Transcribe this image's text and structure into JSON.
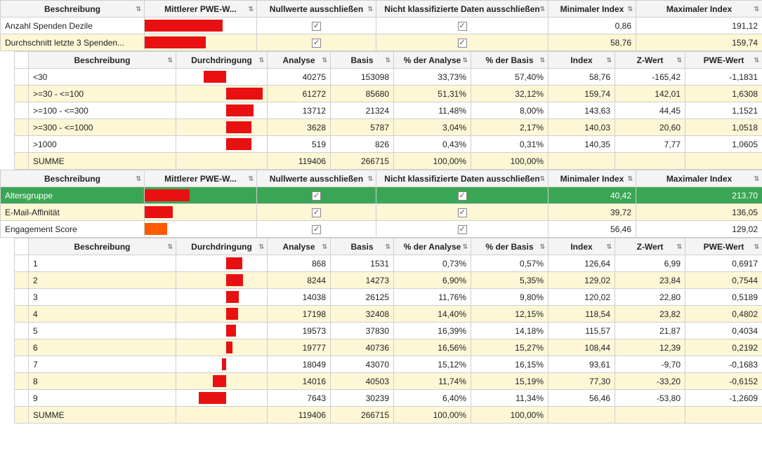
{
  "masterHeaders": {
    "beschreibung": "Beschreibung",
    "mittlererPWE": "Mittlerer  PWE-W...",
    "nullwerte": "Nullwerte ausschließen",
    "nichtKlass": "Nicht klassifizierte Daten ausschließen",
    "minIndex": "Minimaler Index",
    "maxIndex": "Maximaler Index"
  },
  "detailHeaders": {
    "beschreibung": "Beschreibung",
    "durchdringung": "Durchdringung",
    "analyse": "Analyse",
    "basis": "Basis",
    "pctAnalyse": "% der Analyse",
    "pctBasis": "% der Basis",
    "index": "Index",
    "zwert": "Z-Wert",
    "pwe": "PWE-Wert"
  },
  "master1": [
    {
      "name": "Anzahl Spenden Dezile",
      "barStart": 0,
      "barWidth": 70,
      "chk1": true,
      "chk2": true,
      "min": "0,86",
      "max": "191,12",
      "alt": false,
      "sel": false
    },
    {
      "name": "Durchschnitt letzte  3  Spenden...",
      "barStart": 0,
      "barWidth": 55,
      "chk1": true,
      "chk2": true,
      "min": "58,76",
      "max": "159,74",
      "alt": true,
      "sel": false
    }
  ],
  "detail1": [
    {
      "name": "<30",
      "barStart": 30,
      "barWidth": 25,
      "analyse": "40275",
      "basis": "153098",
      "pctA": "33,73%",
      "pctB": "57,40%",
      "idx": "58,76",
      "z": "-165,42",
      "pwe": "-1,1831",
      "alt": false
    },
    {
      "name": ">=30 - <=100",
      "barStart": 55,
      "barWidth": 40,
      "analyse": "61272",
      "basis": "85680",
      "pctA": "51,31%",
      "pctB": "32,12%",
      "idx": "159,74",
      "z": "142,01",
      "pwe": "1,6308",
      "alt": true
    },
    {
      "name": ">=100 - <=300",
      "barStart": 55,
      "barWidth": 30,
      "analyse": "13712",
      "basis": "21324",
      "pctA": "11,48%",
      "pctB": "8,00%",
      "idx": "143,63",
      "z": "44,45",
      "pwe": "1,1521",
      "alt": false
    },
    {
      "name": ">=300 - <=1000",
      "barStart": 55,
      "barWidth": 28,
      "analyse": "3628",
      "basis": "5787",
      "pctA": "3,04%",
      "pctB": "2,17%",
      "idx": "140,03",
      "z": "20,60",
      "pwe": "1,0518",
      "alt": true
    },
    {
      "name": ">1000",
      "barStart": 55,
      "barWidth": 28,
      "analyse": "519",
      "basis": "826",
      "pctA": "0,43%",
      "pctB": "0,31%",
      "idx": "140,35",
      "z": "7,77",
      "pwe": "1,0605",
      "alt": false
    },
    {
      "name": "SUMME",
      "barStart": 0,
      "barWidth": 0,
      "analyse": "119406",
      "basis": "266715",
      "pctA": "100,00%",
      "pctB": "100,00%",
      "idx": "",
      "z": "",
      "pwe": "",
      "alt": true
    }
  ],
  "master2": [
    {
      "name": "Altersgruppe",
      "barStart": 0,
      "barWidth": 40,
      "barClass": "",
      "chk1": true,
      "chk2": true,
      "min": "40,42",
      "max": "213,70",
      "alt": false,
      "sel": true
    },
    {
      "name": "E-Mail-Affinität",
      "barStart": 0,
      "barWidth": 25,
      "barClass": "",
      "chk1": true,
      "chk2": true,
      "min": "39,72",
      "max": "136,05",
      "alt": true,
      "sel": false
    },
    {
      "name": "Engagement Score",
      "barStart": 0,
      "barWidth": 20,
      "barClass": "orange",
      "chk1": true,
      "chk2": true,
      "min": "56,46",
      "max": "129,02",
      "alt": false,
      "sel": false
    }
  ],
  "detail2": [
    {
      "name": "1",
      "barStart": 55,
      "barWidth": 18,
      "analyse": "868",
      "basis": "1531",
      "pctA": "0,73%",
      "pctB": "0,57%",
      "idx": "126,64",
      "z": "6,99",
      "pwe": "0,6917",
      "alt": false
    },
    {
      "name": "2",
      "barStart": 55,
      "barWidth": 19,
      "analyse": "8244",
      "basis": "14273",
      "pctA": "6,90%",
      "pctB": "5,35%",
      "idx": "129,02",
      "z": "23,84",
      "pwe": "0,7544",
      "alt": true
    },
    {
      "name": "3",
      "barStart": 55,
      "barWidth": 14,
      "analyse": "14038",
      "basis": "26125",
      "pctA": "11,76%",
      "pctB": "9,80%",
      "idx": "120,02",
      "z": "22,80",
      "pwe": "0,5189",
      "alt": false
    },
    {
      "name": "4",
      "barStart": 55,
      "barWidth": 13,
      "analyse": "17198",
      "basis": "32408",
      "pctA": "14,40%",
      "pctB": "12,15%",
      "idx": "118,54",
      "z": "23,82",
      "pwe": "0,4802",
      "alt": true
    },
    {
      "name": "5",
      "barStart": 55,
      "barWidth": 11,
      "analyse": "19573",
      "basis": "37830",
      "pctA": "16,39%",
      "pctB": "14,18%",
      "idx": "115,57",
      "z": "21,87",
      "pwe": "0,4034",
      "alt": false
    },
    {
      "name": "6",
      "barStart": 55,
      "barWidth": 7,
      "analyse": "19777",
      "basis": "40736",
      "pctA": "16,56%",
      "pctB": "15,27%",
      "idx": "108,44",
      "z": "12,39",
      "pwe": "0,2192",
      "alt": true
    },
    {
      "name": "7",
      "barStart": 50,
      "barWidth": 5,
      "analyse": "18049",
      "basis": "43070",
      "pctA": "15,12%",
      "pctB": "16,15%",
      "idx": "93,61",
      "z": "-9,70",
      "pwe": "-0,1683",
      "alt": false
    },
    {
      "name": "8",
      "barStart": 40,
      "barWidth": 15,
      "analyse": "14016",
      "basis": "40503",
      "pctA": "11,74%",
      "pctB": "15,19%",
      "idx": "77,30",
      "z": "-33,20",
      "pwe": "-0,6152",
      "alt": true
    },
    {
      "name": "9",
      "barStart": 25,
      "barWidth": 30,
      "analyse": "7643",
      "basis": "30239",
      "pctA": "6,40%",
      "pctB": "11,34%",
      "idx": "56,46",
      "z": "-53,80",
      "pwe": "-1,2609",
      "alt": false
    },
    {
      "name": "SUMME",
      "barStart": 0,
      "barWidth": 0,
      "analyse": "119406",
      "basis": "266715",
      "pctA": "100,00%",
      "pctB": "100,00%",
      "idx": "",
      "z": "",
      "pwe": "",
      "alt": true
    }
  ]
}
